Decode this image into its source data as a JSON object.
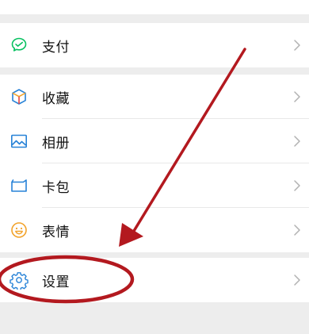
{
  "menu": {
    "pay": {
      "label": "支付",
      "icon": "wechat-pay-icon"
    },
    "favorites": {
      "label": "收藏",
      "icon": "cube-icon"
    },
    "album": {
      "label": "相册",
      "icon": "picture-icon"
    },
    "cards": {
      "label": "卡包",
      "icon": "wallet-icon"
    },
    "stickers": {
      "label": "表情",
      "icon": "smiley-icon"
    },
    "settings": {
      "label": "设置",
      "icon": "gear-icon"
    }
  },
  "colors": {
    "background": "#ededed",
    "surface": "#ffffff",
    "pay_green": "#07c160",
    "album_blue": "#2782d7",
    "sticker_orange": "#f2a32b",
    "annotation_red": "#b3191f"
  }
}
